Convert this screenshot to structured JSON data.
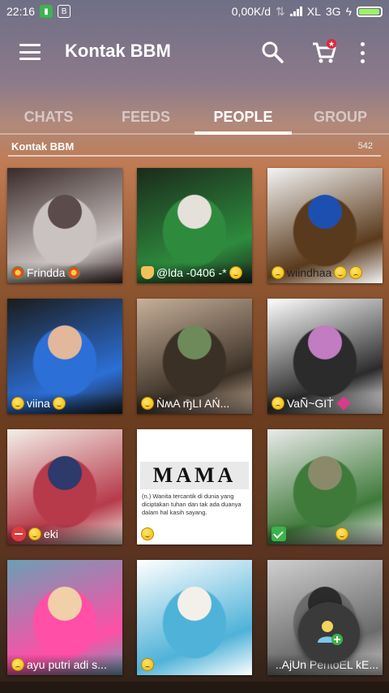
{
  "status_bar": {
    "time": "22:16",
    "network_speed": "0,00K/d",
    "carrier": "XL",
    "network_type": "3G",
    "battery_color": "#9ef06a",
    "battery_level": 0.95
  },
  "app_bar": {
    "title": "Kontak BBM",
    "icons": [
      "menu-icon",
      "search-icon",
      "cart-icon",
      "more-icon"
    ]
  },
  "tabs": [
    {
      "label": "CHATS",
      "active": false
    },
    {
      "label": "FEEDS",
      "active": false
    },
    {
      "label": "PEOPLE",
      "active": true
    },
    {
      "label": "GROUP",
      "active": false
    }
  ],
  "subheader": {
    "title": "Kontak BBM",
    "count": "542"
  },
  "contacts": [
    {
      "name": "Frindda",
      "colors": [
        "#3a2a2a",
        "#c9c2c0",
        "#5b4b4b"
      ]
    },
    {
      "name": "@lda -0406 -*",
      "colors": [
        "#1b2a1b",
        "#2e8b3e",
        "#e6e0da"
      ]
    },
    {
      "name": "wiindhaa",
      "colors": [
        "#f4f4f4",
        "#5a3a1c",
        "#1d4fb0"
      ]
    },
    {
      "name": "viina",
      "colors": [
        "#1b1b1b",
        "#2c6fd6",
        "#e2b79b"
      ]
    },
    {
      "name": "ǸʍA ɱ̄LI AŃ...",
      "colors": [
        "#c7b09a",
        "#3b3026",
        "#6f8a5a"
      ]
    },
    {
      "name": "VaÑ~GIṪ",
      "colors": [
        "#ffffff",
        "#2b2b2b",
        "#c27cc2"
      ]
    },
    {
      "name": "eki",
      "colors": [
        "#f3efe8",
        "#b63a4a",
        "#2d3a6b"
      ]
    },
    {
      "name": "",
      "colors": [
        "#ffffff",
        "#e9e9e9",
        "#333333"
      ]
    },
    {
      "name": "",
      "colors": [
        "#eaeaea",
        "#3f7a3a",
        "#8a8a6a"
      ]
    },
    {
      "name": "ayu putri adi s...",
      "colors": [
        "#6b9fb5",
        "#ff4fa6",
        "#f1cfa8"
      ]
    },
    {
      "name": "",
      "colors": [
        "#ffffff",
        "#4fb2d8",
        "#f3f0ea"
      ]
    },
    {
      "name": "..AjUn PentoEL kE...",
      "colors": [
        "#cfcfcf",
        "#6b6b6b",
        "#2b2b2b"
      ]
    }
  ],
  "mama_card": {
    "heading": "MAMA",
    "body": "(n.) Wanita tercantik di dunia yang diciptakan tuhan dan tak ada duanya dalam hal kasih sayang."
  },
  "fab": {
    "icon": "add-contact-icon"
  }
}
